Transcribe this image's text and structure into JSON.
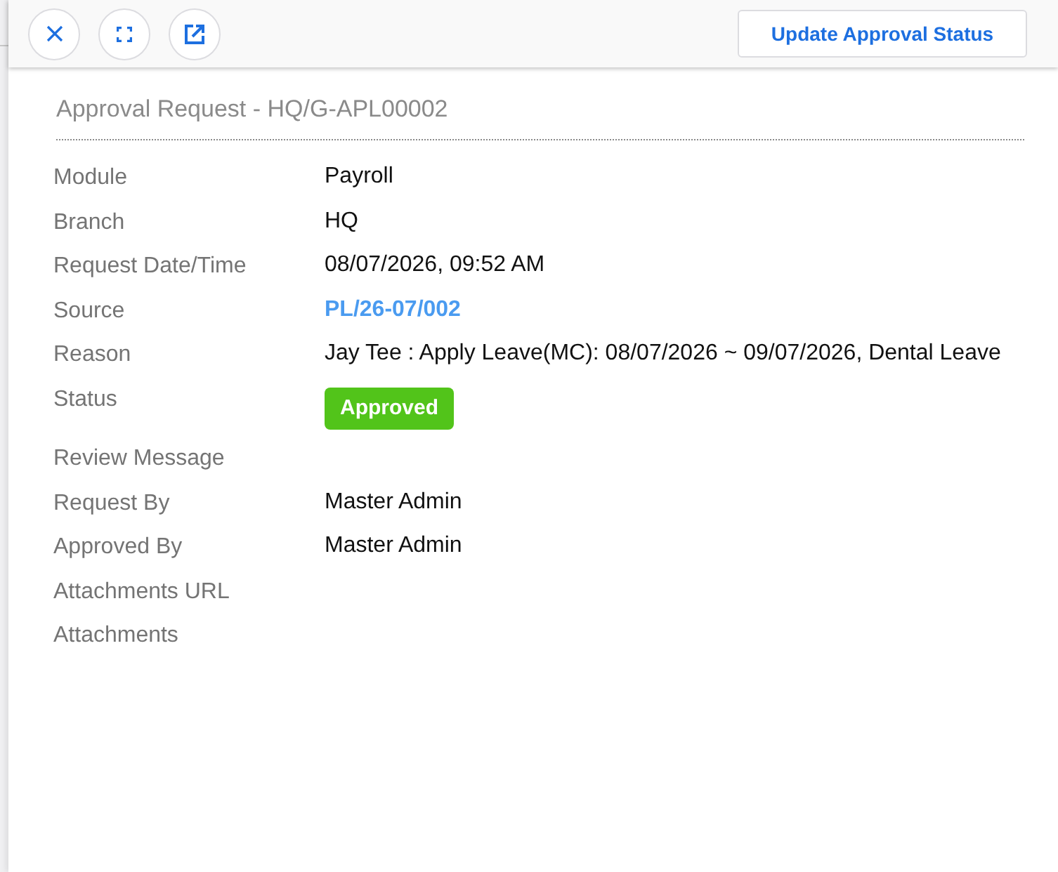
{
  "header": {
    "action_button": "Update Approval Status"
  },
  "title": "Approval Request - HQ/G-APL00002",
  "fields": [
    {
      "label": "Module",
      "kind": "text",
      "value": "Payroll"
    },
    {
      "label": "Branch",
      "kind": "text",
      "value": "HQ"
    },
    {
      "label": "Request Date/Time",
      "kind": "text",
      "value": "08/07/2026, 09:52 AM"
    },
    {
      "label": "Source",
      "kind": "link",
      "value": "PL/26-07/002"
    },
    {
      "label": "Reason",
      "kind": "text",
      "value": "Jay Tee : Apply Leave(MC): 08/07/2026 ~ 09/07/2026, Dental Leave"
    },
    {
      "label": "Status",
      "kind": "badge",
      "value": "Approved"
    },
    {
      "label": "Review Message",
      "kind": "empty"
    },
    {
      "label": "Request By",
      "kind": "text",
      "value": "Master Admin"
    },
    {
      "label": "Approved By",
      "kind": "text",
      "value": "Master Admin"
    },
    {
      "label": "Attachments URL",
      "kind": "empty"
    },
    {
      "label": "Attachments",
      "kind": "empty"
    }
  ]
}
